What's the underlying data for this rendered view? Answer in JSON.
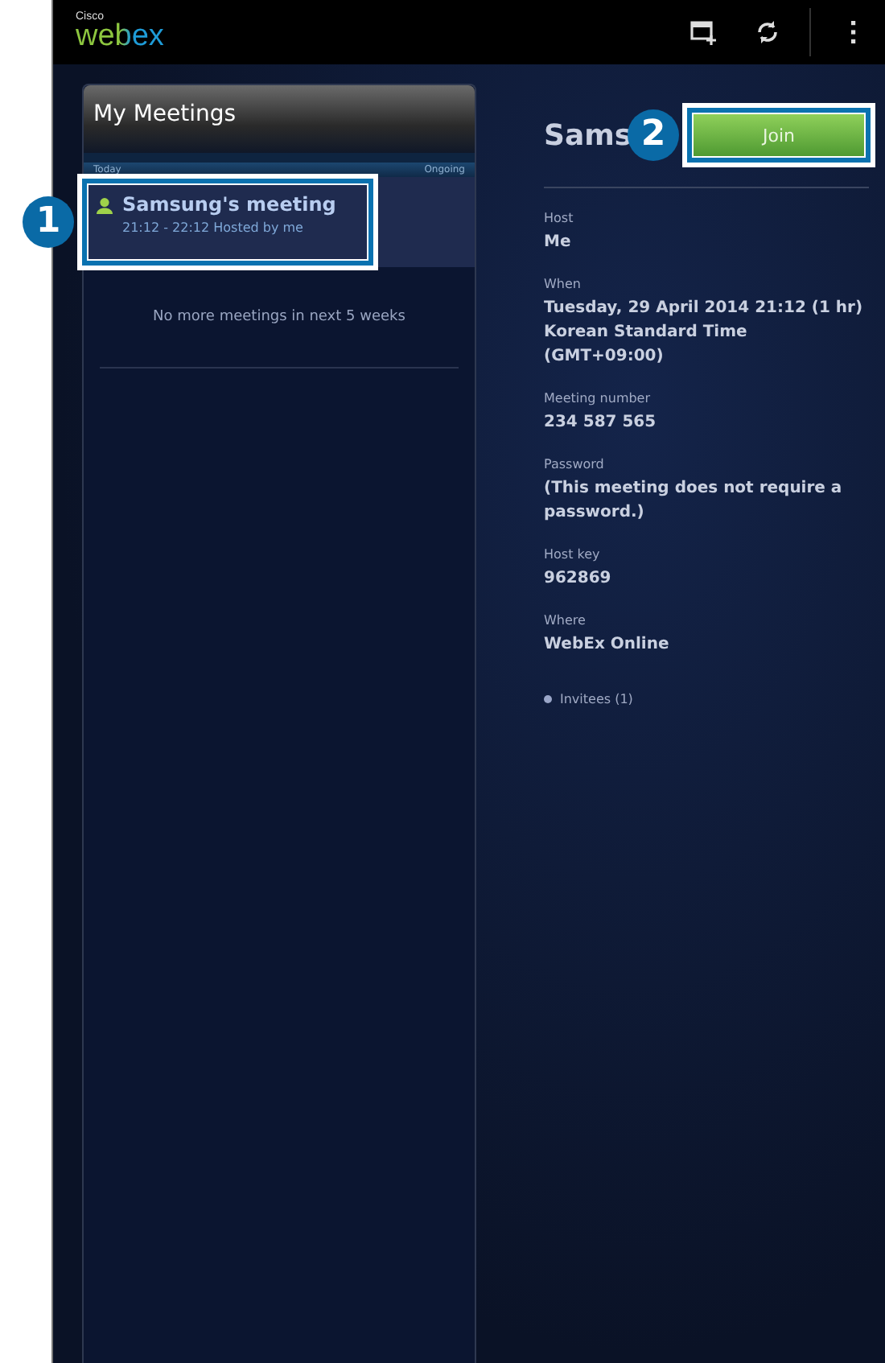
{
  "app_bar": {
    "logo_brand": "Cisco",
    "logo_name": "webex",
    "actions": [
      {
        "kind": "new-meeting"
      },
      {
        "kind": "refresh"
      },
      {
        "kind": "menu"
      }
    ]
  },
  "meetings_panel": {
    "title": "My Meetings",
    "columns": [
      "Today",
      "Ongoing"
    ],
    "meetings": [
      {
        "title": "Samsung's meeting",
        "subtitle": "21:12 - 22:12  Hosted by me",
        "selected": true,
        "callout": "1"
      }
    ],
    "empty_note": "No more meetings in next 5 weeks"
  },
  "detail": {
    "title": "Sams",
    "join_button": {
      "label": "Join",
      "callout": "2"
    },
    "fields": [
      {
        "label": "Host",
        "value": "Me"
      },
      {
        "label": "When",
        "value": "Tuesday, 29 April 2014 21:12 (1 hr)",
        "extra": [
          "Korean Standard Time",
          "(GMT+09:00)"
        ]
      },
      {
        "label": "Meeting number",
        "value": "234 587 565"
      },
      {
        "label": "Password",
        "value": "(This meeting does not require a password.)"
      },
      {
        "label": "Host key",
        "value": "962869"
      },
      {
        "label": "Where",
        "value": "WebEx Online"
      }
    ],
    "invitees": "Invitees (1)"
  }
}
